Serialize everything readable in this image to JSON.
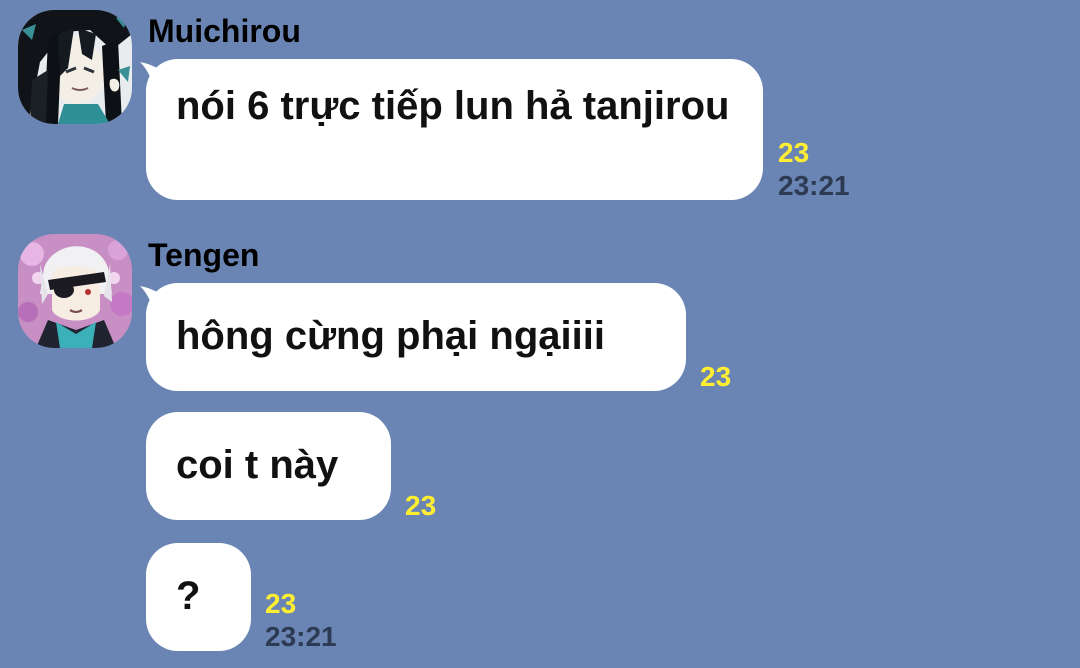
{
  "colors": {
    "background": "#6a85b4",
    "bubble": "#ffffff",
    "read_count": "#ffee32",
    "timestamp": "#2d3a54"
  },
  "messages": [
    {
      "sender": "Muichirou",
      "avatar_icon": "muichirou-avatar-icon",
      "text": "nói 6 trực tiếp lun hả tanjirou",
      "read_count": "23",
      "time": "23:21"
    },
    {
      "sender": "Tengen",
      "avatar_icon": "tengen-avatar-icon",
      "text": "hông cừng phại ngạiiii",
      "read_count": "23"
    },
    {
      "text": "coi t này",
      "read_count": "23"
    },
    {
      "text": "?",
      "read_count": "23",
      "time": "23:21"
    }
  ]
}
